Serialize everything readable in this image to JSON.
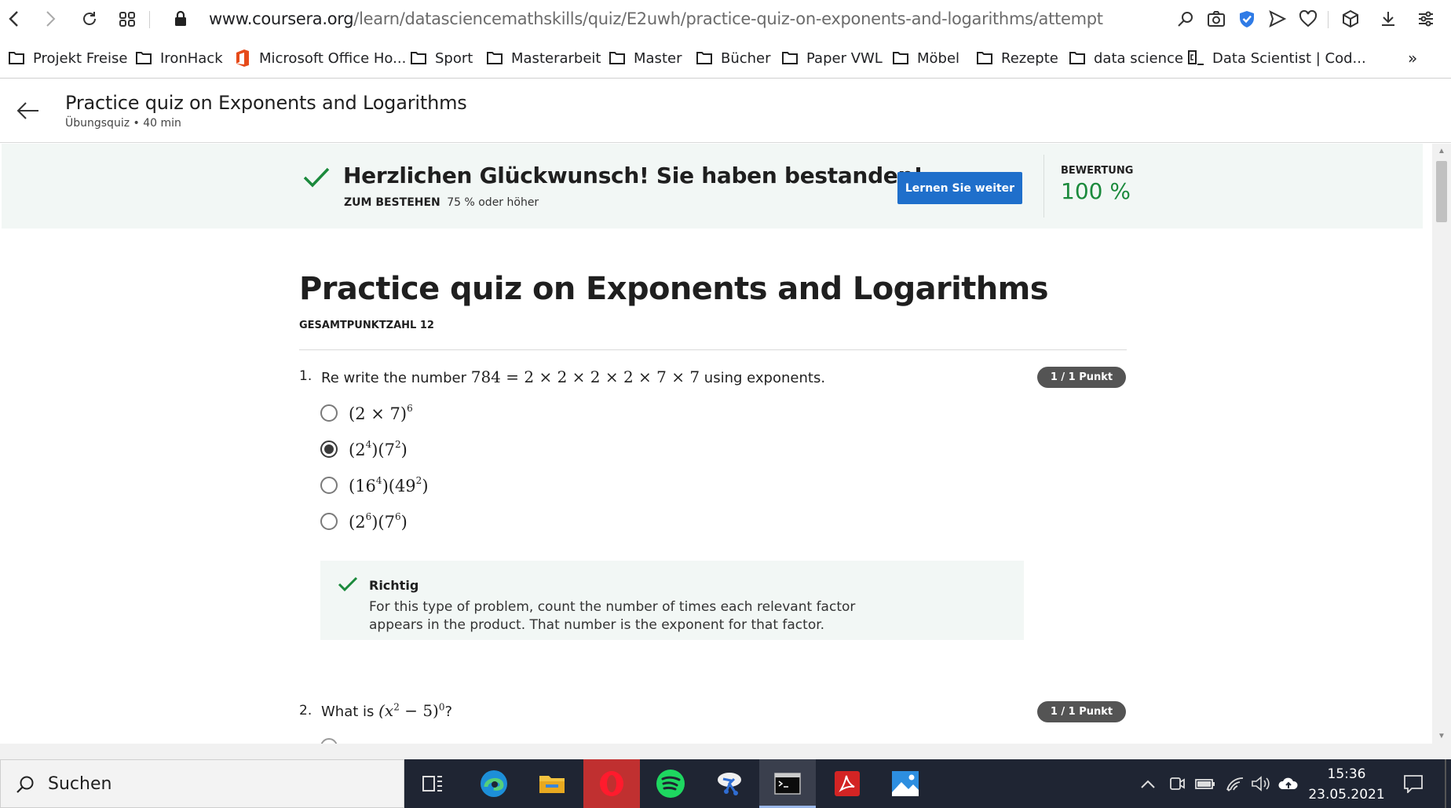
{
  "browser": {
    "url_host": "www.coursera.org",
    "url_path": "/learn/datasciencemathskills/quiz/E2uwh/practice-quiz-on-exponents-and-logarithms/attempt"
  },
  "bookmarks": [
    {
      "label": "Projekt Freise",
      "icon": "folder-icon"
    },
    {
      "label": "IronHack",
      "icon": "folder-icon"
    },
    {
      "label": "Microsoft Office Ho...",
      "icon": "office-icon"
    },
    {
      "label": "Sport",
      "icon": "folder-icon"
    },
    {
      "label": "Masterarbeit",
      "icon": "folder-icon"
    },
    {
      "label": "Master",
      "icon": "folder-icon"
    },
    {
      "label": "Bücher",
      "icon": "folder-icon"
    },
    {
      "label": "Paper VWL",
      "icon": "folder-icon"
    },
    {
      "label": "Möbel",
      "icon": "folder-icon"
    },
    {
      "label": "Rezepte",
      "icon": "folder-icon"
    },
    {
      "label": "data science",
      "icon": "folder-icon"
    },
    {
      "label": "Data Scientist | Cod...",
      "icon": "datacamp-icon"
    }
  ],
  "bookmarks_more": "»",
  "header": {
    "title": "Practice quiz on Exponents and Logarithms",
    "subtitle": "Übungsquiz • 40 min"
  },
  "banner": {
    "title": "Herzlichen Glückwunsch! Sie haben bestanden!",
    "pass_label": "ZUM BESTEHEN",
    "pass_value": "75 % oder höher",
    "continue_button": "Lernen Sie weiter",
    "grade_label": "BEWERTUNG",
    "grade_value": "100 %",
    "accent_color": "#1f6fcb",
    "success_color": "#1b8a3c"
  },
  "quiz": {
    "title": "Practice quiz on Exponents and Logarithms",
    "total_points": "GESAMTPUNKTZAHL 12",
    "questions": [
      {
        "number": "1.",
        "text_before": "Re write the number ",
        "math": "784 = 2 × 2 × 2 × 2 × 7 × 7",
        "text_after": " using exponents.",
        "points": "1 / 1 Punkt",
        "options": [
          {
            "base1": "(2 × 7)",
            "exp1": "6",
            "selected": false
          },
          {
            "base1": "(2",
            "exp1": "4",
            "base2": ")(7",
            "exp2": "2",
            "tail": ")",
            "selected": true
          },
          {
            "base1": "(16",
            "exp1": "4",
            "base2": ")(49",
            "exp2": "2",
            "tail": ")",
            "selected": false
          },
          {
            "base1": "(2",
            "exp1": "6",
            "base2": ")(7",
            "exp2": "6",
            "tail": ")",
            "selected": false
          }
        ],
        "feedback": {
          "title": "Richtig",
          "text": "For this type of problem, count the number of times each relevant factor appears in the product. That number is the exponent for that factor."
        }
      },
      {
        "number": "2.",
        "text_before": "What is ",
        "math_base": "(x",
        "math_exp1": "2",
        "math_mid": " − 5)",
        "math_exp2": "0",
        "text_after": "?",
        "points": "1 / 1 Punkt"
      }
    ]
  },
  "taskbar": {
    "search_placeholder": "Suchen",
    "time": "15:36",
    "date": "23.05.2021"
  }
}
